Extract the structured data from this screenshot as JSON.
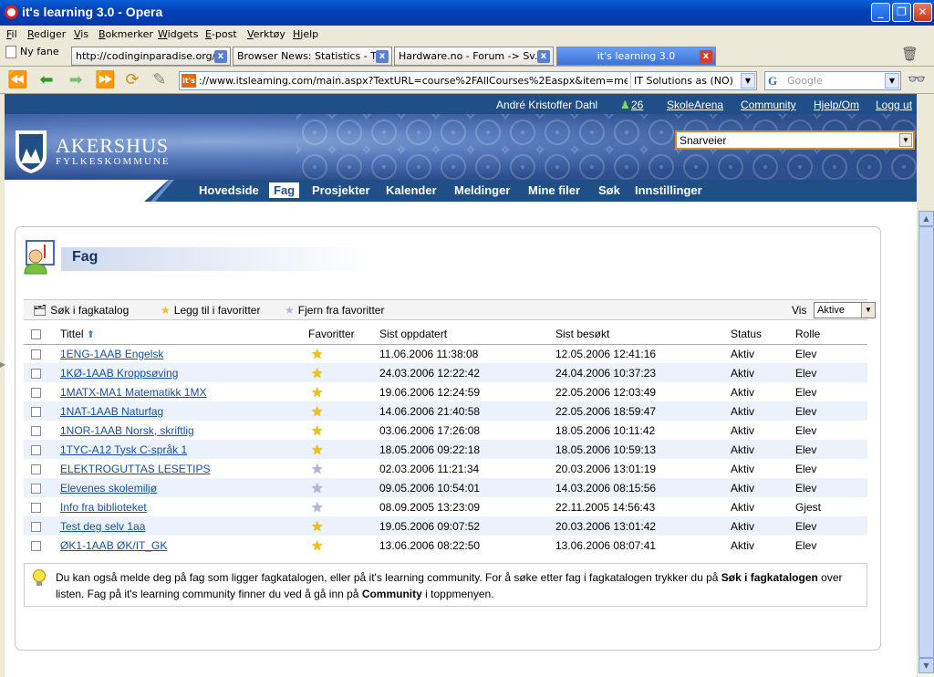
{
  "window": {
    "title": "it's learning 3.0 - Opera"
  },
  "menu": [
    "Fil",
    "Rediger",
    "Vis",
    "Bokmerker",
    "Widgets",
    "E-post",
    "Verktøy",
    "Hjelp"
  ],
  "newtab_label": "Ny fane",
  "tabs": [
    {
      "label": "http://codinginparadise.org/..."
    },
    {
      "label": "Browser News: Statistics - Tr..."
    },
    {
      "label": "Hardware.no - Forum -> Sv..."
    },
    {
      "label": "it's learning 3.0"
    }
  ],
  "address": {
    "url": "://www.itsleaming.com/main.aspx?TextURL=course%2FAllCourses%2Easpx&item=menu_course",
    "site": "IT Solutions as (NO)",
    "favicon": "it's"
  },
  "search": {
    "engine": "G",
    "placeholder": "Google"
  },
  "topstrip": {
    "user": "André Kristoffer Dahl",
    "online_count": "26",
    "skolearena": "SkoleArena",
    "community": "Community",
    "help": "Hjelp/Om",
    "logout": "Logg ut"
  },
  "logo": {
    "name": "AKERSHUS",
    "sub": "FYLKESKOMMUNE"
  },
  "shortcuts": "Snarveier",
  "mainnav": [
    "Hovedside",
    "Fag",
    "Prosjekter",
    "Kalender",
    "Meldinger",
    "Mine filer",
    "Søk",
    "Innstillinger"
  ],
  "heading": "Fag",
  "toolbar": {
    "search_catalog": "Søk i fagkatalog",
    "add_fav": "Legg til i favoritter",
    "remove_fav": "Fjern fra favoritter",
    "vis_label": "Vis",
    "vis_value": "Aktive"
  },
  "columns": {
    "title": "Tittel",
    "favorites": "Favoritter",
    "updated": "Sist oppdatert",
    "visited": "Sist besøkt",
    "status": "Status",
    "role": "Rolle"
  },
  "courses": [
    {
      "title": "1ENG-1AAB Engelsk",
      "fav": true,
      "updated": "11.06.2006 11:38:08",
      "visited": "12.05.2006 12:41:16",
      "status": "Aktiv",
      "role": "Elev"
    },
    {
      "title": "1KØ-1AAB Kroppsøving",
      "fav": true,
      "updated": "24.03.2006 12:22:42",
      "visited": "24.04.2006 10:37:23",
      "status": "Aktiv",
      "role": "Elev"
    },
    {
      "title": "1MATX-MA1 Matematikk 1MX",
      "fav": true,
      "updated": "19.06.2006 12:24:59",
      "visited": "22.05.2006 12:03:49",
      "status": "Aktiv",
      "role": "Elev"
    },
    {
      "title": "1NAT-1AAB Naturfag",
      "fav": true,
      "updated": "14.06.2006 21:40:58",
      "visited": "22.05.2006 18:59:47",
      "status": "Aktiv",
      "role": "Elev"
    },
    {
      "title": "1NOR-1AAB Norsk, skriftlig",
      "fav": true,
      "updated": "03.06.2006 17:26:08",
      "visited": "18.05.2006 10:11:42",
      "status": "Aktiv",
      "role": "Elev"
    },
    {
      "title": "1TYC-A12 Tysk C-språk 1",
      "fav": true,
      "updated": "18.05.2006 09:22:18",
      "visited": "18.05.2006 10:59:13",
      "status": "Aktiv",
      "role": "Elev"
    },
    {
      "title": "ELEKTROGUTTAS LESETIPS",
      "fav": false,
      "updated": "02.03.2006 11:21:34",
      "visited": "20.03.2006 13:01:19",
      "status": "Aktiv",
      "role": "Elev"
    },
    {
      "title": "Elevenes skolemiljø",
      "fav": false,
      "updated": "09.05.2006 10:54:01",
      "visited": "14.03.2006 08:15:56",
      "status": "Aktiv",
      "role": "Elev"
    },
    {
      "title": "Info fra biblioteket",
      "fav": false,
      "updated": "08.09.2005 13:23:09",
      "visited": "22.11.2005 14:56:43",
      "status": "Aktiv",
      "role": "Gjest"
    },
    {
      "title": "Test deg selv 1aa",
      "fav": true,
      "updated": "19.05.2006 09:07:52",
      "visited": "20.03.2006 13:01:42",
      "status": "Aktiv",
      "role": "Elev"
    },
    {
      "title": "ØK1-1AAB ØK/IT_GK",
      "fav": true,
      "updated": "13.06.2006 08:22:50",
      "visited": "13.06.2006 08:07:41",
      "status": "Aktiv",
      "role": "Elev"
    }
  ],
  "tip": {
    "p1": "Du kan også melde deg på fag som ligger fagkatalogen, eller på it's learning community. For å søke etter fag i fagkatalogen trykker du på ",
    "b1": "Søk i fagkatalogen",
    "p2": " over listen. Fag på it's learning community finner du ved å gå inn på ",
    "b2": "Community",
    "p3": " i toppmenyen."
  },
  "colors": {
    "brand_blue": "#1f4f86",
    "link": "#1a4fa0",
    "row_alt": "#ecf2fb",
    "star": "#f2c200"
  }
}
